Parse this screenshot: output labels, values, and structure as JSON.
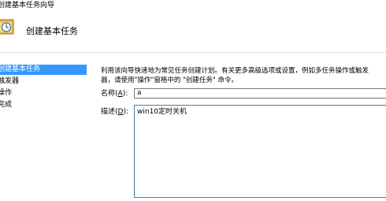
{
  "window": {
    "title": "创建基本任务向导"
  },
  "header": {
    "title": "创建基本任务",
    "icon": "task-scheduler-icon"
  },
  "sidebar": {
    "items": [
      {
        "label": "创建基本任务",
        "selected": true
      },
      {
        "label": "触发器",
        "selected": false
      },
      {
        "label": "操作",
        "selected": false
      },
      {
        "label": "完成",
        "selected": false
      }
    ]
  },
  "main": {
    "description_line1": "利用该向导快速地为常见任务创建计划。有关更多高级选项或设置，例如多任务操作或触发",
    "description_line2": "器，请使用\"操作\"窗格中的 \"创建任务\" 命令。",
    "name_label": {
      "text": "名称",
      "accel_open": "(",
      "accel": "A",
      "accel_close": "):"
    },
    "name_value": "a",
    "desc_label": {
      "text": "描述",
      "accel_open": "(",
      "accel": "D",
      "accel_close": "):"
    },
    "desc_value": "win10定时关机"
  },
  "colors": {
    "selection": "#3399ff",
    "focus_border": "#3c7fb1"
  }
}
